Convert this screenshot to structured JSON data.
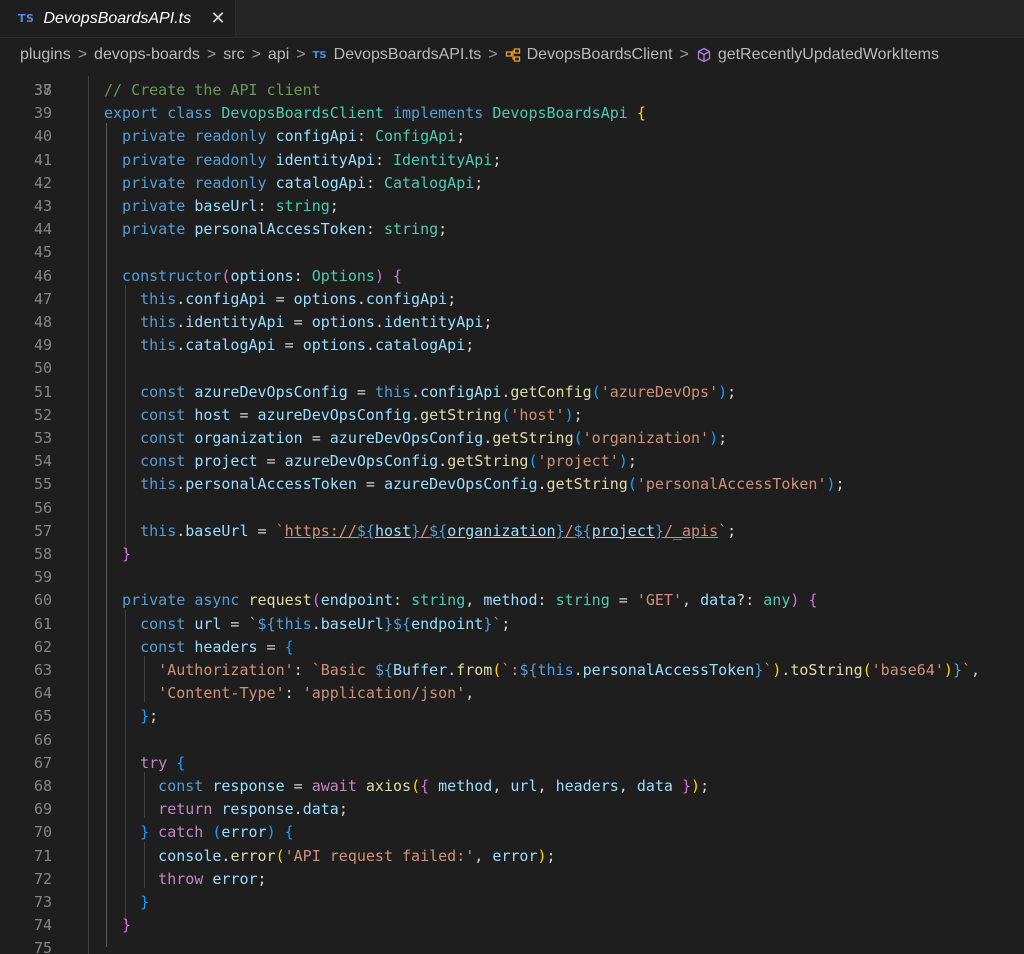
{
  "tab": {
    "badge": "TS",
    "title": "DevopsBoardsAPI.ts",
    "close_glyph": "✕"
  },
  "breadcrumb": {
    "items": [
      "plugins",
      "devops-boards",
      "src",
      "api",
      "DevopsBoardsAPI.ts",
      "DevopsBoardsClient",
      "getRecentlyUpdatedWorkItems"
    ],
    "ts_badge": "TS",
    "separator": ">"
  },
  "editor": {
    "language": "typescript",
    "partial_top_line": "37",
    "lines": [
      {
        "n": "38",
        "tokens": [
          [
            "com",
            "// Create the API client"
          ]
        ]
      },
      {
        "n": "39",
        "tokens": [
          [
            "kw",
            "export "
          ],
          [
            "kw",
            "class "
          ],
          [
            "cls",
            "DevopsBoardsClient "
          ],
          [
            "kw",
            "implements "
          ],
          [
            "cls",
            "DevopsBoardsApi "
          ],
          [
            "br1",
            "{"
          ]
        ]
      },
      {
        "n": "40",
        "tokens": [
          [
            "kw",
            "  private "
          ],
          [
            "kw",
            "readonly "
          ],
          [
            "var",
            "configApi"
          ],
          [
            "pun",
            ": "
          ],
          [
            "cls",
            "ConfigApi"
          ],
          [
            "pun",
            ";"
          ]
        ]
      },
      {
        "n": "41",
        "tokens": [
          [
            "kw",
            "  private "
          ],
          [
            "kw",
            "readonly "
          ],
          [
            "var",
            "identityApi"
          ],
          [
            "pun",
            ": "
          ],
          [
            "cls",
            "IdentityApi"
          ],
          [
            "pun",
            ";"
          ]
        ]
      },
      {
        "n": "42",
        "tokens": [
          [
            "kw",
            "  private "
          ],
          [
            "kw",
            "readonly "
          ],
          [
            "var",
            "catalogApi"
          ],
          [
            "pun",
            ": "
          ],
          [
            "cls",
            "CatalogApi"
          ],
          [
            "pun",
            ";"
          ]
        ]
      },
      {
        "n": "43",
        "tokens": [
          [
            "kw",
            "  private "
          ],
          [
            "var",
            "baseUrl"
          ],
          [
            "pun",
            ": "
          ],
          [
            "cls",
            "string"
          ],
          [
            "pun",
            ";"
          ]
        ]
      },
      {
        "n": "44",
        "tokens": [
          [
            "kw",
            "  private "
          ],
          [
            "var",
            "personalAccessToken"
          ],
          [
            "pun",
            ": "
          ],
          [
            "cls",
            "string"
          ],
          [
            "pun",
            ";"
          ]
        ]
      },
      {
        "n": "45",
        "tokens": []
      },
      {
        "n": "46",
        "tokens": [
          [
            "kw",
            "  constructor"
          ],
          [
            "br2",
            "("
          ],
          [
            "var",
            "options"
          ],
          [
            "pun",
            ": "
          ],
          [
            "cls",
            "Options"
          ],
          [
            "br2",
            ")"
          ],
          [
            "pun",
            " "
          ],
          [
            "br2",
            "{"
          ]
        ]
      },
      {
        "n": "47",
        "tokens": [
          [
            "kw",
            "    this"
          ],
          [
            "pun",
            "."
          ],
          [
            "var",
            "configApi"
          ],
          [
            "pun",
            " = "
          ],
          [
            "var",
            "options"
          ],
          [
            "pun",
            "."
          ],
          [
            "var",
            "configApi"
          ],
          [
            "pun",
            ";"
          ]
        ]
      },
      {
        "n": "48",
        "tokens": [
          [
            "kw",
            "    this"
          ],
          [
            "pun",
            "."
          ],
          [
            "var",
            "identityApi"
          ],
          [
            "pun",
            " = "
          ],
          [
            "var",
            "options"
          ],
          [
            "pun",
            "."
          ],
          [
            "var",
            "identityApi"
          ],
          [
            "pun",
            ";"
          ]
        ]
      },
      {
        "n": "49",
        "tokens": [
          [
            "kw",
            "    this"
          ],
          [
            "pun",
            "."
          ],
          [
            "var",
            "catalogApi"
          ],
          [
            "pun",
            " = "
          ],
          [
            "var",
            "options"
          ],
          [
            "pun",
            "."
          ],
          [
            "var",
            "catalogApi"
          ],
          [
            "pun",
            ";"
          ]
        ]
      },
      {
        "n": "50",
        "tokens": []
      },
      {
        "n": "51",
        "tokens": [
          [
            "kw",
            "    const "
          ],
          [
            "var",
            "azureDevOpsConfig"
          ],
          [
            "pun",
            " = "
          ],
          [
            "kw",
            "this"
          ],
          [
            "pun",
            "."
          ],
          [
            "var",
            "configApi"
          ],
          [
            "pun",
            "."
          ],
          [
            "fn",
            "getConfig"
          ],
          [
            "br3",
            "("
          ],
          [
            "str",
            "'azureDevOps'"
          ],
          [
            "br3",
            ")"
          ],
          [
            "pun",
            ";"
          ]
        ]
      },
      {
        "n": "52",
        "tokens": [
          [
            "kw",
            "    const "
          ],
          [
            "var",
            "host"
          ],
          [
            "pun",
            " = "
          ],
          [
            "var",
            "azureDevOpsConfig"
          ],
          [
            "pun",
            "."
          ],
          [
            "fn",
            "getString"
          ],
          [
            "br3",
            "("
          ],
          [
            "str",
            "'host'"
          ],
          [
            "br3",
            ")"
          ],
          [
            "pun",
            ";"
          ]
        ]
      },
      {
        "n": "53",
        "tokens": [
          [
            "kw",
            "    const "
          ],
          [
            "var",
            "organization"
          ],
          [
            "pun",
            " = "
          ],
          [
            "var",
            "azureDevOpsConfig"
          ],
          [
            "pun",
            "."
          ],
          [
            "fn",
            "getString"
          ],
          [
            "br3",
            "("
          ],
          [
            "str",
            "'organization'"
          ],
          [
            "br3",
            ")"
          ],
          [
            "pun",
            ";"
          ]
        ]
      },
      {
        "n": "54",
        "tokens": [
          [
            "kw",
            "    const "
          ],
          [
            "var",
            "project"
          ],
          [
            "pun",
            " = "
          ],
          [
            "var",
            "azureDevOpsConfig"
          ],
          [
            "pun",
            "."
          ],
          [
            "fn",
            "getString"
          ],
          [
            "br3",
            "("
          ],
          [
            "str",
            "'project'"
          ],
          [
            "br3",
            ")"
          ],
          [
            "pun",
            ";"
          ]
        ]
      },
      {
        "n": "55",
        "tokens": [
          [
            "kw",
            "    this"
          ],
          [
            "pun",
            "."
          ],
          [
            "var",
            "personalAccessToken"
          ],
          [
            "pun",
            " = "
          ],
          [
            "var",
            "azureDevOpsConfig"
          ],
          [
            "pun",
            "."
          ],
          [
            "fn",
            "getString"
          ],
          [
            "br3",
            "("
          ],
          [
            "str",
            "'personalAccessToken'"
          ],
          [
            "br3",
            ")"
          ],
          [
            "pun",
            ";"
          ]
        ]
      },
      {
        "n": "56",
        "tokens": []
      },
      {
        "n": "57",
        "tokens": [
          [
            "kw",
            "    this"
          ],
          [
            "pun",
            "."
          ],
          [
            "var",
            "baseUrl"
          ],
          [
            "pun",
            " = "
          ],
          [
            "str",
            "`"
          ],
          [
            "url",
            "https://"
          ],
          [
            "urlkw",
            "${"
          ],
          [
            "urlvar",
            "host"
          ],
          [
            "urlkw",
            "}"
          ],
          [
            "url",
            "/"
          ],
          [
            "urlkw",
            "${"
          ],
          [
            "urlvar",
            "organization"
          ],
          [
            "urlkw",
            "}"
          ],
          [
            "url",
            "/"
          ],
          [
            "urlkw",
            "${"
          ],
          [
            "urlvar",
            "project"
          ],
          [
            "urlkw",
            "}"
          ],
          [
            "url",
            "/_apis"
          ],
          [
            "str",
            "`"
          ],
          [
            "pun",
            ";"
          ]
        ]
      },
      {
        "n": "58",
        "tokens": [
          [
            "br2",
            "  }"
          ]
        ]
      },
      {
        "n": "59",
        "tokens": []
      },
      {
        "n": "60",
        "tokens": [
          [
            "kw",
            "  private "
          ],
          [
            "kw",
            "async "
          ],
          [
            "fn",
            "request"
          ],
          [
            "br2",
            "("
          ],
          [
            "var",
            "endpoint"
          ],
          [
            "pun",
            ": "
          ],
          [
            "cls",
            "string"
          ],
          [
            "pun",
            ", "
          ],
          [
            "var",
            "method"
          ],
          [
            "pun",
            ": "
          ],
          [
            "cls",
            "string"
          ],
          [
            "pun",
            " = "
          ],
          [
            "str",
            "'GET'"
          ],
          [
            "pun",
            ", "
          ],
          [
            "var",
            "data"
          ],
          [
            "pun",
            "?: "
          ],
          [
            "cls",
            "any"
          ],
          [
            "br2",
            ")"
          ],
          [
            "pun",
            " "
          ],
          [
            "br2",
            "{"
          ]
        ]
      },
      {
        "n": "61",
        "tokens": [
          [
            "kw",
            "    const "
          ],
          [
            "var",
            "url"
          ],
          [
            "pun",
            " = "
          ],
          [
            "str",
            "`"
          ],
          [
            "kw",
            "${"
          ],
          [
            "kw",
            "this"
          ],
          [
            "pun",
            "."
          ],
          [
            "var",
            "baseUrl"
          ],
          [
            "kw",
            "}"
          ],
          [
            "kw",
            "${"
          ],
          [
            "var",
            "endpoint"
          ],
          [
            "kw",
            "}"
          ],
          [
            "str",
            "`"
          ],
          [
            "pun",
            ";"
          ]
        ]
      },
      {
        "n": "62",
        "tokens": [
          [
            "kw",
            "    const "
          ],
          [
            "var",
            "headers"
          ],
          [
            "pun",
            " = "
          ],
          [
            "br3",
            "{"
          ]
        ]
      },
      {
        "n": "63",
        "tokens": [
          [
            "str",
            "      'Authorization'"
          ],
          [
            "pun",
            ": "
          ],
          [
            "str",
            "`Basic "
          ],
          [
            "kw",
            "${"
          ],
          [
            "var",
            "Buffer"
          ],
          [
            "pun",
            "."
          ],
          [
            "fn",
            "from"
          ],
          [
            "br1",
            "("
          ],
          [
            "str",
            "`:"
          ],
          [
            "kw",
            "${"
          ],
          [
            "kw",
            "this"
          ],
          [
            "pun",
            "."
          ],
          [
            "var",
            "personalAccessToken"
          ],
          [
            "kw",
            "}"
          ],
          [
            "str",
            "`"
          ],
          [
            "br1",
            ")"
          ],
          [
            "pun",
            "."
          ],
          [
            "fn",
            "toString"
          ],
          [
            "br1",
            "("
          ],
          [
            "str",
            "'base64'"
          ],
          [
            "br1",
            ")"
          ],
          [
            "kw",
            "}"
          ],
          [
            "str",
            "`"
          ],
          [
            "pun",
            ","
          ]
        ]
      },
      {
        "n": "64",
        "tokens": [
          [
            "str",
            "      'Content-Type'"
          ],
          [
            "pun",
            ": "
          ],
          [
            "str",
            "'application/json'"
          ],
          [
            "pun",
            ","
          ]
        ]
      },
      {
        "n": "65",
        "tokens": [
          [
            "br3",
            "    }"
          ],
          [
            "pun",
            ";"
          ]
        ]
      },
      {
        "n": "66",
        "tokens": []
      },
      {
        "n": "67",
        "tokens": [
          [
            "ctl",
            "    try "
          ],
          [
            "br3",
            "{"
          ]
        ]
      },
      {
        "n": "68",
        "tokens": [
          [
            "kw",
            "      const "
          ],
          [
            "var",
            "response"
          ],
          [
            "pun",
            " = "
          ],
          [
            "ctl",
            "await "
          ],
          [
            "fn",
            "axios"
          ],
          [
            "br1",
            "("
          ],
          [
            "br2",
            "{"
          ],
          [
            "pun",
            " "
          ],
          [
            "var",
            "method"
          ],
          [
            "pun",
            ", "
          ],
          [
            "var",
            "url"
          ],
          [
            "pun",
            ", "
          ],
          [
            "var",
            "headers"
          ],
          [
            "pun",
            ", "
          ],
          [
            "var",
            "data"
          ],
          [
            "pun",
            " "
          ],
          [
            "br2",
            "}"
          ],
          [
            "br1",
            ")"
          ],
          [
            "pun",
            ";"
          ]
        ]
      },
      {
        "n": "69",
        "tokens": [
          [
            "ctl",
            "      return "
          ],
          [
            "var",
            "response"
          ],
          [
            "pun",
            "."
          ],
          [
            "var",
            "data"
          ],
          [
            "pun",
            ";"
          ]
        ]
      },
      {
        "n": "70",
        "tokens": [
          [
            "br3",
            "    }"
          ],
          [
            "ctl",
            " catch "
          ],
          [
            "br3",
            "("
          ],
          [
            "var",
            "error"
          ],
          [
            "br3",
            ")"
          ],
          [
            "pun",
            " "
          ],
          [
            "br3",
            "{"
          ]
        ]
      },
      {
        "n": "71",
        "tokens": [
          [
            "var",
            "      console"
          ],
          [
            "pun",
            "."
          ],
          [
            "fn",
            "error"
          ],
          [
            "br1",
            "("
          ],
          [
            "str",
            "'API request failed:'"
          ],
          [
            "pun",
            ", "
          ],
          [
            "var",
            "error"
          ],
          [
            "br1",
            ")"
          ],
          [
            "pun",
            ";"
          ]
        ]
      },
      {
        "n": "72",
        "tokens": [
          [
            "ctl",
            "      throw "
          ],
          [
            "var",
            "error"
          ],
          [
            "pun",
            ";"
          ]
        ]
      },
      {
        "n": "73",
        "tokens": [
          [
            "br3",
            "    }"
          ]
        ]
      },
      {
        "n": "74",
        "tokens": [
          [
            "br2",
            "  }"
          ]
        ]
      },
      {
        "n": "75",
        "tokens": []
      }
    ]
  },
  "colors": {
    "background": "#1e1e1e",
    "keyword": "#569cd6",
    "control": "#c586c0",
    "type": "#4ec9b0",
    "variable": "#9cdcfe",
    "function": "#dcdcaa",
    "string": "#ce9178",
    "comment": "#6a9955"
  }
}
